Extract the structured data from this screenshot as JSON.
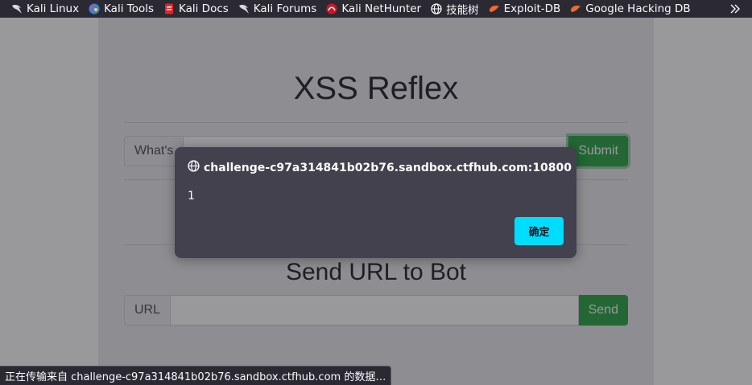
{
  "bookmarks": [
    {
      "label": "Kali Linux",
      "icon": "kali-dragon-icon"
    },
    {
      "label": "Kali Tools",
      "icon": "kali-tools-icon"
    },
    {
      "label": "Kali Docs",
      "icon": "kali-docs-icon"
    },
    {
      "label": "Kali Forums",
      "icon": "kali-dragon-icon"
    },
    {
      "label": "Kali NetHunter",
      "icon": "nethunter-icon"
    },
    {
      "label": "技能树",
      "icon": "globe-icon"
    },
    {
      "label": "Exploit-DB",
      "icon": "exploit-db-icon"
    },
    {
      "label": "Google Hacking DB",
      "icon": "exploit-db-icon"
    }
  ],
  "page": {
    "title": "XSS Reflex",
    "name_label": "What's",
    "submit_label": "Submit",
    "send_title": "Send URL to Bot",
    "url_label": "URL",
    "send_label": "Send"
  },
  "dialog": {
    "origin": "challenge-c97a314841b02b76.sandbox.ctfhub.com:10800",
    "message": "1",
    "ok_label": "确定"
  },
  "status": {
    "text": "正在传输来自 challenge-c97a314841b02b76.sandbox.ctfhub.com 的数据…"
  },
  "colors": {
    "accent_ok": "#00ddff",
    "success": "#28a745"
  }
}
